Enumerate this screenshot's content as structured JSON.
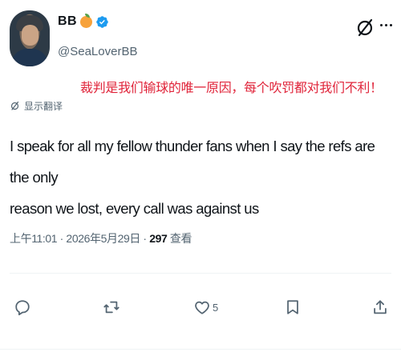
{
  "user": {
    "display_name": "BB",
    "handle": "@SeaLoverBB",
    "badges": [
      "peach-icon",
      "verified-icon"
    ],
    "verified_color": "#1d9bf0"
  },
  "annotation": "裁判是我们输球的唯一原因，每个吹罚都对我们不利！",
  "translate_label": "显示翻译",
  "tweet": {
    "line1": "I speak for all my fellow thunder fans when I say the refs are the only",
    "line2": "reason we lost, every call was against us"
  },
  "meta": {
    "timestamp": "上午11:01 · 2026年5月29日 · ",
    "views_count": "297",
    "views_label": " 查看"
  },
  "actions": {
    "reply_count": "",
    "retweet_count": "",
    "like_count": "5",
    "bookmark_count": "",
    "share_count": ""
  },
  "colors": {
    "text": "#0f1419",
    "secondary": "#536471",
    "annotation": "#e0243a"
  }
}
